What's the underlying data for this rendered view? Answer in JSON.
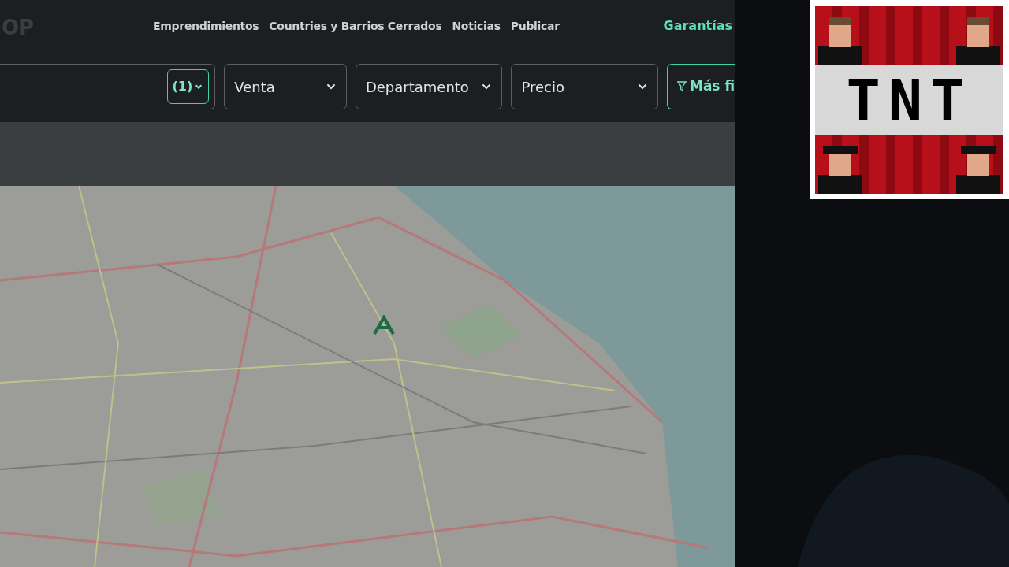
{
  "header": {
    "logo": "OP",
    "nav": [
      {
        "label": "Emprendimientos"
      },
      {
        "label": "Countries y Barrios Cerrados"
      },
      {
        "label": "Noticias"
      },
      {
        "label": "Publicar"
      }
    ],
    "guarantees": "Garantías"
  },
  "filters": {
    "location_count": "(1)",
    "dropdowns": [
      {
        "label": "Venta"
      },
      {
        "label": "Departamento"
      },
      {
        "label": "Precio"
      }
    ],
    "more_filters": "Más fi"
  },
  "overlay": {
    "title": "TNT"
  }
}
